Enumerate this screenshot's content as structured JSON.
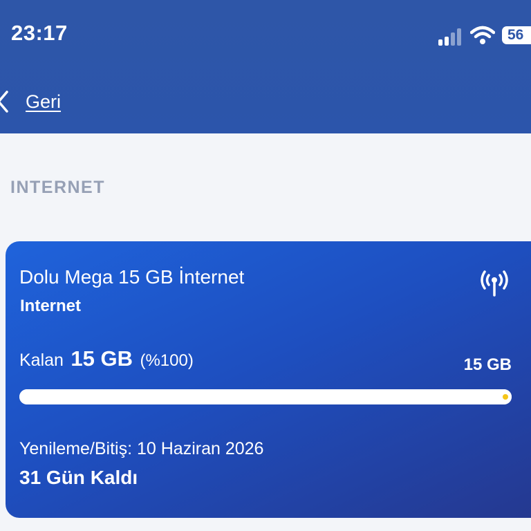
{
  "status_bar": {
    "time": "23:17",
    "battery": "56",
    "signal_icon": "cellular-signal-icon",
    "wifi_icon": "wifi-icon"
  },
  "nav": {
    "back_label": "Geri",
    "back_icon": "chevron-left-icon"
  },
  "section": {
    "title": "INTERNET"
  },
  "package": {
    "name": "Dolu Mega 15 GB İnternet",
    "type": "Internet",
    "icon": "antenna-icon",
    "remaining_label": "Kalan",
    "remaining_value": "15 GB",
    "remaining_percent": "(%100)",
    "total": "15 GB",
    "progress_fraction": 1.0,
    "renewal_text": "Yenileme/Bitiş: 10 Haziran 2026",
    "days_left": "31 Gün Kaldı"
  },
  "colors": {
    "header_bg": "#2e56a8",
    "card_gradient_start": "#1f63db",
    "card_gradient_end": "#25388f",
    "page_bg": "#f3f5f9",
    "section_title": "#96a0b5",
    "progress_dot": "#f5c518"
  }
}
